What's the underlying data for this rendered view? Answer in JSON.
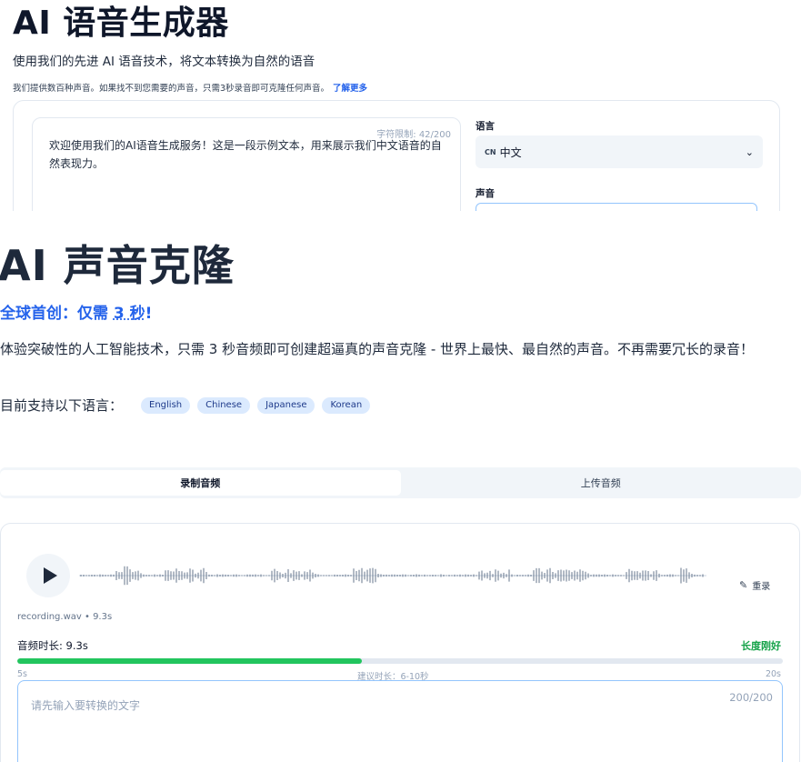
{
  "generator": {
    "title": "AI 语音生成器",
    "subtitle": "使用我们的先进 AI 语音技术，将文本转换为自然的语音",
    "note": "我们提供数百种声音。如果找不到您需要的声音，只需3秒录音即可克隆任何声音。",
    "learn_more": "了解更多",
    "char_limit": "字符限制:  42/200",
    "sample_text": "欢迎使用我们的AI语音生成服务！这是一段示例文本，用来展示我们中文语音的自然表现力。",
    "language_label": "语言",
    "language_flag": "CN",
    "language_value": "中文",
    "voice_label": "声音"
  },
  "clone": {
    "title": "AI 声音克隆",
    "highlight_prefix": "全球首创：仅需 ",
    "highlight_emph": "3 秒",
    "highlight_suffix": "!",
    "description": "体验突破性的人工智能技术，只需 3 秒音频即可创建超逼真的声音克隆 - 世界上最快、最自然的声音。不再需要冗长的录音！",
    "languages_label": "目前支持以下语言：",
    "languages": [
      "English",
      "Chinese",
      "Japanese",
      "Korean"
    ],
    "tabs": [
      {
        "label": "录制音频",
        "active": true
      },
      {
        "label": "上传音频",
        "active": false
      }
    ],
    "reset_label": "重录",
    "file_info": "recording.wav • 9.3s",
    "duration_label": "音频时长: 9.3s",
    "duration_status": "长度刚好",
    "duration_progress": 0.45,
    "scale_min": "5s",
    "scale_mid": "建议时长：6-10秒",
    "scale_max": "20s",
    "input_placeholder": "请先输入要转换的文字",
    "input_count": "200/200"
  },
  "colors": {
    "accent_blue": "#2563eb",
    "success_green": "#22c55e",
    "chip_bg": "#dbeafe"
  },
  "icons": {
    "play": "play-icon",
    "reset": "pencil-icon",
    "dropdown": "chevron-down-icon"
  }
}
